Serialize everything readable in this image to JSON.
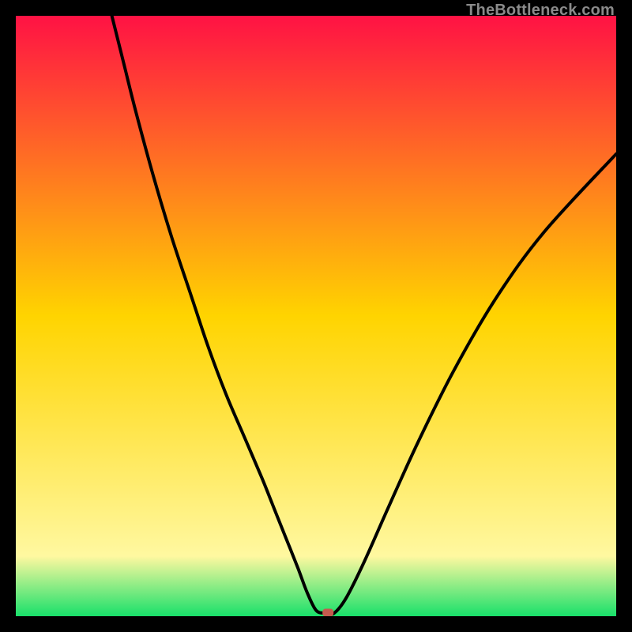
{
  "watermark": "TheBottleneck.com",
  "chart_data": {
    "type": "line",
    "title": "",
    "xlabel": "",
    "ylabel": "",
    "xlim": [
      0,
      100
    ],
    "ylim": [
      0,
      100
    ],
    "grid": false,
    "series": [
      {
        "name": "bottleneck-curve",
        "x": [
          16,
          18,
          20,
          23,
          26,
          29,
          32,
          35,
          38,
          41,
          43,
          45,
          47,
          48.5,
          50,
          51.5,
          53,
          55,
          58,
          62,
          67,
          73,
          80,
          88,
          100
        ],
        "y": [
          100,
          92,
          84,
          73,
          63,
          54,
          45,
          37,
          30,
          23,
          18,
          13,
          8,
          4,
          1,
          0.5,
          0.5,
          3,
          9,
          18,
          29,
          41,
          53,
          64,
          77
        ]
      }
    ],
    "marker": {
      "x": 52,
      "y": 0.6,
      "color": "#c55a4e"
    },
    "background_gradient": {
      "stops": [
        {
          "pct": 0,
          "color": "#ff1244"
        },
        {
          "pct": 50,
          "color": "#ffd400"
        },
        {
          "pct": 90,
          "color": "#fff8a0"
        },
        {
          "pct": 100,
          "color": "#18e06a"
        }
      ]
    }
  }
}
